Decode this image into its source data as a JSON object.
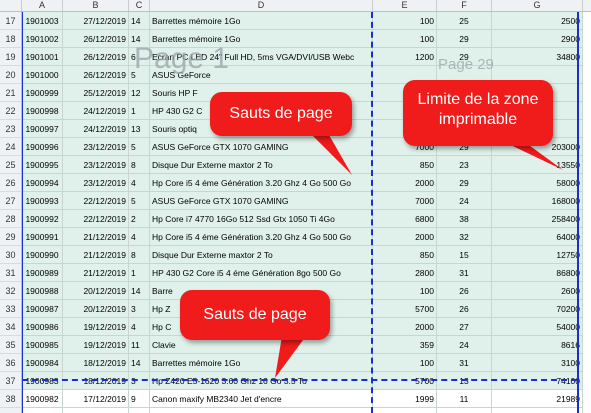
{
  "columns": [
    "A",
    "B",
    "C",
    "D",
    "E",
    "F",
    "G"
  ],
  "rows": [
    {
      "n": "17",
      "a": "1901003",
      "b": "27/12/2019",
      "c": "14",
      "d": "Barrettes mémoire 1Go",
      "e": "100",
      "f": "25",
      "g": "2500"
    },
    {
      "n": "18",
      "a": "1901002",
      "b": "26/12/2019",
      "c": "14",
      "d": "Barrettes mémoire 1Go",
      "e": "100",
      "f": "29",
      "g": "2900"
    },
    {
      "n": "19",
      "a": "1901001",
      "b": "26/12/2019",
      "c": "6",
      "d": "Ecran PC LED 24\" Full HD, 5ms VGA/DVI/USB Webc",
      "e": "1200",
      "f": "29",
      "g": "34800"
    },
    {
      "n": "20",
      "a": "1901000",
      "b": "26/12/2019",
      "c": "5",
      "d": "ASUS GeForce",
      "e": "",
      "f": "",
      "g": ""
    },
    {
      "n": "21",
      "a": "1900999",
      "b": "25/12/2019",
      "c": "12",
      "d": "Souris HP F",
      "e": "",
      "f": "",
      "g": ""
    },
    {
      "n": "22",
      "a": "1900998",
      "b": "24/12/2019",
      "c": "1",
      "d": "HP 430 G2 C",
      "e": "",
      "f": "",
      "g": ""
    },
    {
      "n": "23",
      "a": "1900997",
      "b": "24/12/2019",
      "c": "13",
      "d": "Souris optiq",
      "e": "",
      "f": "",
      "g": ""
    },
    {
      "n": "24",
      "a": "1900996",
      "b": "23/12/2019",
      "c": "5",
      "d": "ASUS GeForce GTX 1070 GAMING",
      "e": "7000",
      "f": "29",
      "g": "203000"
    },
    {
      "n": "25",
      "a": "1900995",
      "b": "23/12/2019",
      "c": "8",
      "d": "Disque Dur Externe maxtor 2 To",
      "e": "850",
      "f": "23",
      "g": "13550"
    },
    {
      "n": "26",
      "a": "1900994",
      "b": "23/12/2019",
      "c": "4",
      "d": "Hp Core i5 4 éme Génération 3.20 Ghz 4 Go 500 Go",
      "e": "2000",
      "f": "29",
      "g": "58000"
    },
    {
      "n": "27",
      "a": "1900993",
      "b": "22/12/2019",
      "c": "5",
      "d": "ASUS GeForce GTX 1070 GAMING",
      "e": "7000",
      "f": "24",
      "g": "168000"
    },
    {
      "n": "28",
      "a": "1900992",
      "b": "22/12/2019",
      "c": "2",
      "d": "Hp Core i7 4770 16Go 512 Ssd Gtx 1050 Ti 4Go",
      "e": "6800",
      "f": "38",
      "g": "258400"
    },
    {
      "n": "29",
      "a": "1900991",
      "b": "21/12/2019",
      "c": "4",
      "d": "Hp Core i5 4 éme Génération 3.20 Ghz 4 Go 500 Go",
      "e": "2000",
      "f": "32",
      "g": "64000"
    },
    {
      "n": "30",
      "a": "1900990",
      "b": "21/12/2019",
      "c": "8",
      "d": "Disque Dur Externe maxtor 2 To",
      "e": "850",
      "f": "15",
      "g": "12750"
    },
    {
      "n": "31",
      "a": "1900989",
      "b": "21/12/2019",
      "c": "1",
      "d": "HP 430 G2 Core i5 4 éme Génération 8go 500 Go",
      "e": "2800",
      "f": "31",
      "g": "86800"
    },
    {
      "n": "32",
      "a": "1900988",
      "b": "20/12/2019",
      "c": "14",
      "d": "Barre",
      "e": "100",
      "f": "26",
      "g": "2600"
    },
    {
      "n": "33",
      "a": "1900987",
      "b": "20/12/2019",
      "c": "3",
      "d": "Hp Z",
      "e": "5700",
      "f": "26",
      "g": "70200"
    },
    {
      "n": "34",
      "a": "1900986",
      "b": "19/12/2019",
      "c": "4",
      "d": "Hp C",
      "e": "2000",
      "f": "27",
      "g": "54000"
    },
    {
      "n": "35",
      "a": "1900985",
      "b": "19/12/2019",
      "c": "11",
      "d": "Clavie",
      "e": "359",
      "f": "24",
      "g": "8616"
    },
    {
      "n": "36",
      "a": "1900984",
      "b": "18/12/2019",
      "c": "14",
      "d": "Barrettes mémoire 1Go",
      "e": "100",
      "f": "31",
      "g": "3100"
    },
    {
      "n": "37",
      "a": "1900983",
      "b": "18/12/2019",
      "c": "3",
      "d": "Hp Z420 E5-1620 3.60 Ghz 16 Go 3.5 To",
      "e": "5700",
      "f": "13",
      "g": "74100"
    },
    {
      "n": "38",
      "a": "1900982",
      "b": "17/12/2019",
      "c": "9",
      "d": "Canon maxify MB2340 Jet d'encre",
      "e": "1999",
      "f": "11",
      "g": "21989"
    },
    {
      "n": "39",
      "a": "1900981",
      "b": "17/12/2019",
      "c": "3",
      "d": "Hp Z420 E5-1620 3.60 Ghz 16 Go 3.5 To",
      "e": "5700",
      "f": "39",
      "g": "222300"
    }
  ],
  "watermarks": {
    "page1": "Page 1",
    "page2": "Page 29"
  },
  "callouts": {
    "saut1": "Sauts de page",
    "limite": "Limite de la zone imprimable",
    "saut2": "Sauts de page"
  },
  "colors": {
    "callout": "#f01b1b",
    "page_break": "#1a2fd1",
    "cell_fill": "#dff1ea"
  }
}
